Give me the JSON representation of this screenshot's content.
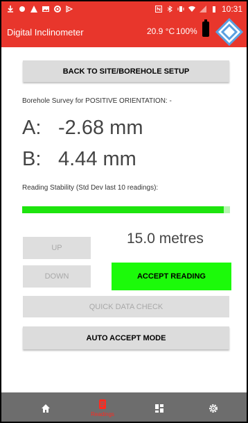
{
  "colors": {
    "primary_red": "#e8362c",
    "accept_green": "#1cfa0a",
    "stability_green": "#1ee40e",
    "button_grey": "#dcdcdc",
    "nav_grey": "#6d6d6d"
  },
  "status_bar": {
    "time": "10:31",
    "left_icons": [
      "download-icon",
      "dot-icon",
      "alert-icon",
      "image-icon",
      "record-icon",
      "play-icon"
    ],
    "right_icons": [
      "nfc-icon",
      "bluetooth-icon",
      "vibrate-icon",
      "wifi-icon",
      "signal-icon",
      "battery-icon"
    ]
  },
  "app_bar": {
    "title": "Digital Inclinometer",
    "temperature": "20.9 °C",
    "battery_percent": "100%",
    "logo_icon": "diamond-logo-icon"
  },
  "buttons": {
    "back": "BACK TO SITE/BOREHOLE SETUP",
    "up": "UP",
    "down": "DOWN",
    "accept": "ACCEPT READING",
    "quick_check": "QUICK DATA CHECK",
    "auto_accept": "AUTO ACCEPT MODE"
  },
  "survey": {
    "label": "Borehole Survey for POSITIVE ORIENTATION: -",
    "a_label": "A:",
    "a_value": "-2.68 mm",
    "b_label": "B:",
    "b_value": "4.44 mm"
  },
  "stability": {
    "label": "Reading Stability (Std Dev last 10 readings):",
    "level": 0.97
  },
  "depth": "15.0 metres",
  "bottom_nav": {
    "active": "Readings",
    "items": [
      {
        "icon": "home-icon",
        "label": ""
      },
      {
        "icon": "readings-icon",
        "label": "Readings"
      },
      {
        "icon": "dashboard-icon",
        "label": ""
      },
      {
        "icon": "settings-icon",
        "label": ""
      }
    ]
  }
}
